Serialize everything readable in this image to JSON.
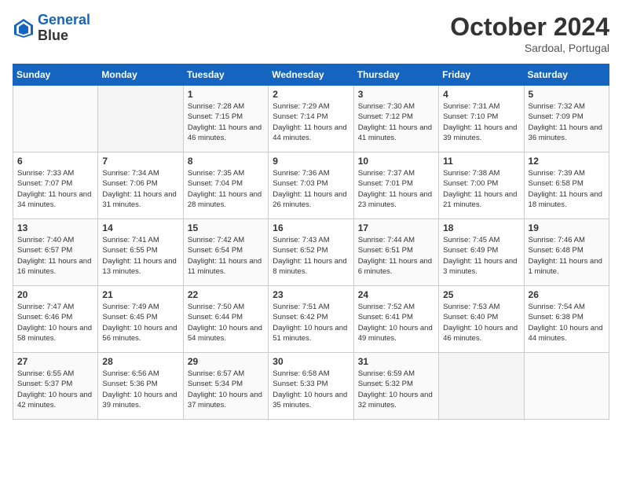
{
  "header": {
    "logo_line1": "General",
    "logo_line2": "Blue",
    "month": "October 2024",
    "location": "Sardoal, Portugal"
  },
  "weekdays": [
    "Sunday",
    "Monday",
    "Tuesday",
    "Wednesday",
    "Thursday",
    "Friday",
    "Saturday"
  ],
  "weeks": [
    [
      {
        "day": "",
        "info": ""
      },
      {
        "day": "",
        "info": ""
      },
      {
        "day": "1",
        "info": "Sunrise: 7:28 AM\nSunset: 7:15 PM\nDaylight: 11 hours and 46 minutes."
      },
      {
        "day": "2",
        "info": "Sunrise: 7:29 AM\nSunset: 7:14 PM\nDaylight: 11 hours and 44 minutes."
      },
      {
        "day": "3",
        "info": "Sunrise: 7:30 AM\nSunset: 7:12 PM\nDaylight: 11 hours and 41 minutes."
      },
      {
        "day": "4",
        "info": "Sunrise: 7:31 AM\nSunset: 7:10 PM\nDaylight: 11 hours and 39 minutes."
      },
      {
        "day": "5",
        "info": "Sunrise: 7:32 AM\nSunset: 7:09 PM\nDaylight: 11 hours and 36 minutes."
      }
    ],
    [
      {
        "day": "6",
        "info": "Sunrise: 7:33 AM\nSunset: 7:07 PM\nDaylight: 11 hours and 34 minutes."
      },
      {
        "day": "7",
        "info": "Sunrise: 7:34 AM\nSunset: 7:06 PM\nDaylight: 11 hours and 31 minutes."
      },
      {
        "day": "8",
        "info": "Sunrise: 7:35 AM\nSunset: 7:04 PM\nDaylight: 11 hours and 28 minutes."
      },
      {
        "day": "9",
        "info": "Sunrise: 7:36 AM\nSunset: 7:03 PM\nDaylight: 11 hours and 26 minutes."
      },
      {
        "day": "10",
        "info": "Sunrise: 7:37 AM\nSunset: 7:01 PM\nDaylight: 11 hours and 23 minutes."
      },
      {
        "day": "11",
        "info": "Sunrise: 7:38 AM\nSunset: 7:00 PM\nDaylight: 11 hours and 21 minutes."
      },
      {
        "day": "12",
        "info": "Sunrise: 7:39 AM\nSunset: 6:58 PM\nDaylight: 11 hours and 18 minutes."
      }
    ],
    [
      {
        "day": "13",
        "info": "Sunrise: 7:40 AM\nSunset: 6:57 PM\nDaylight: 11 hours and 16 minutes."
      },
      {
        "day": "14",
        "info": "Sunrise: 7:41 AM\nSunset: 6:55 PM\nDaylight: 11 hours and 13 minutes."
      },
      {
        "day": "15",
        "info": "Sunrise: 7:42 AM\nSunset: 6:54 PM\nDaylight: 11 hours and 11 minutes."
      },
      {
        "day": "16",
        "info": "Sunrise: 7:43 AM\nSunset: 6:52 PM\nDaylight: 11 hours and 8 minutes."
      },
      {
        "day": "17",
        "info": "Sunrise: 7:44 AM\nSunset: 6:51 PM\nDaylight: 11 hours and 6 minutes."
      },
      {
        "day": "18",
        "info": "Sunrise: 7:45 AM\nSunset: 6:49 PM\nDaylight: 11 hours and 3 minutes."
      },
      {
        "day": "19",
        "info": "Sunrise: 7:46 AM\nSunset: 6:48 PM\nDaylight: 11 hours and 1 minute."
      }
    ],
    [
      {
        "day": "20",
        "info": "Sunrise: 7:47 AM\nSunset: 6:46 PM\nDaylight: 10 hours and 58 minutes."
      },
      {
        "day": "21",
        "info": "Sunrise: 7:49 AM\nSunset: 6:45 PM\nDaylight: 10 hours and 56 minutes."
      },
      {
        "day": "22",
        "info": "Sunrise: 7:50 AM\nSunset: 6:44 PM\nDaylight: 10 hours and 54 minutes."
      },
      {
        "day": "23",
        "info": "Sunrise: 7:51 AM\nSunset: 6:42 PM\nDaylight: 10 hours and 51 minutes."
      },
      {
        "day": "24",
        "info": "Sunrise: 7:52 AM\nSunset: 6:41 PM\nDaylight: 10 hours and 49 minutes."
      },
      {
        "day": "25",
        "info": "Sunrise: 7:53 AM\nSunset: 6:40 PM\nDaylight: 10 hours and 46 minutes."
      },
      {
        "day": "26",
        "info": "Sunrise: 7:54 AM\nSunset: 6:38 PM\nDaylight: 10 hours and 44 minutes."
      }
    ],
    [
      {
        "day": "27",
        "info": "Sunrise: 6:55 AM\nSunset: 5:37 PM\nDaylight: 10 hours and 42 minutes."
      },
      {
        "day": "28",
        "info": "Sunrise: 6:56 AM\nSunset: 5:36 PM\nDaylight: 10 hours and 39 minutes."
      },
      {
        "day": "29",
        "info": "Sunrise: 6:57 AM\nSunset: 5:34 PM\nDaylight: 10 hours and 37 minutes."
      },
      {
        "day": "30",
        "info": "Sunrise: 6:58 AM\nSunset: 5:33 PM\nDaylight: 10 hours and 35 minutes."
      },
      {
        "day": "31",
        "info": "Sunrise: 6:59 AM\nSunset: 5:32 PM\nDaylight: 10 hours and 32 minutes."
      },
      {
        "day": "",
        "info": ""
      },
      {
        "day": "",
        "info": ""
      }
    ]
  ]
}
